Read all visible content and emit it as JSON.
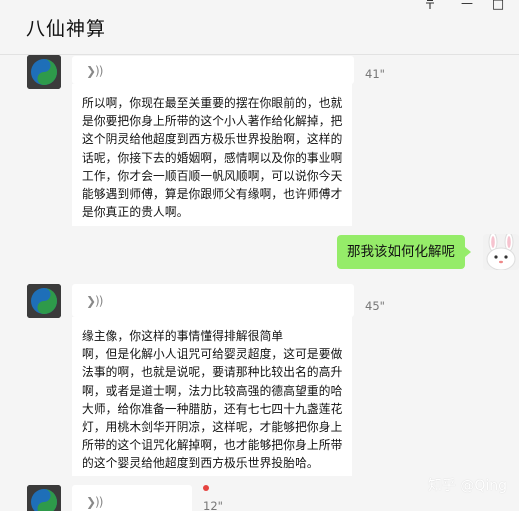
{
  "window": {
    "title": "八仙神算",
    "pin_icon": "pin-icon",
    "minimize_glyph": "—",
    "maximize_glyph": "□"
  },
  "messages": [
    {
      "sender": "other",
      "voice_symbol": "❯))",
      "duration": "41\"",
      "transcript": "所以啊，你现在最至关重要的摆在你眼前的，也就\n是你要把你身上所带的这个小人著作给化解掉，把\n这个阴灵给他超度到西方极乐世界投胎啊，这样的\n话呢，你接下去的婚姻啊，感情啊以及你的事业啊\n工作，你才会一顺百顺一帆风顺啊，可以说你今天\n能够遇到师傅，算是你跟师父有缘啊，也许师傅才\n是你真正的贵人啊。"
    },
    {
      "sender": "me",
      "text": "那我该如何化解呢"
    },
    {
      "sender": "other",
      "voice_symbol": "❯))",
      "duration": "45\"",
      "transcript": "缘主像，你这样的事情懂得排解很简单\n啊，但是化解小人诅咒可给婴灵超度，这可是要做\n法事的啊，也就是说呢，要请那种比较出名的高升\n啊，或者是道士啊，法力比较高强的德高望重的哈\n大师，给你准备一种腊肪，还有七七四十九盏莲花\n灯，用桃木剑华开阴凉，这样呢，才能够把你身上\n所带的这个诅咒化解掉啊，也才能够把你身上所带\n的这个婴灵给他超度到西方极乐世界投胎哈。"
    },
    {
      "sender": "other",
      "voice_symbol": "❯))",
      "duration": "12\"",
      "unread": true
    }
  ],
  "watermark": "知乎 @Qing",
  "colors": {
    "background": "#f5f5f5",
    "bubble_other": "#ffffff",
    "bubble_me": "#95ec69",
    "unread_dot": "#e64340"
  }
}
